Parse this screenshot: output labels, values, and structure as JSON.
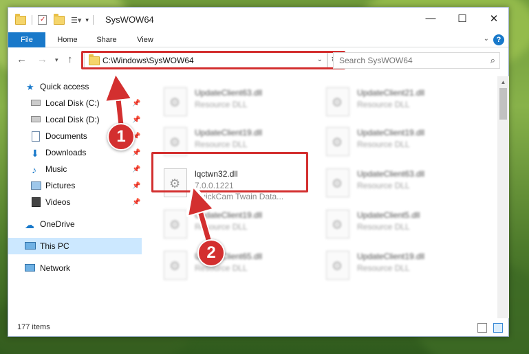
{
  "window": {
    "title": "SysWOW64",
    "controls": {
      "minimize": "—",
      "maximize": "☐",
      "close": "✕"
    }
  },
  "ribbon": {
    "tabs": [
      "File",
      "Home",
      "Share",
      "View"
    ],
    "help": "?"
  },
  "address": {
    "path": "C:\\Windows\\SysWOW64",
    "search_placeholder": "Search SysWOW64"
  },
  "sidebar": {
    "items": [
      {
        "label": "Quick access",
        "icon": "star-icon"
      },
      {
        "label": "Local Disk (C:)",
        "icon": "drive-icon",
        "pinned": true
      },
      {
        "label": "Local Disk (D:)",
        "icon": "drive-icon",
        "pinned": true
      },
      {
        "label": "Documents",
        "icon": "documents-icon",
        "pinned": true
      },
      {
        "label": "Downloads",
        "icon": "downloads-icon",
        "pinned": true
      },
      {
        "label": "Music",
        "icon": "music-icon",
        "pinned": true
      },
      {
        "label": "Pictures",
        "icon": "pictures-icon",
        "pinned": true
      },
      {
        "label": "Videos",
        "icon": "videos-icon",
        "pinned": true
      },
      {
        "label": "OneDrive",
        "icon": "cloud-icon"
      },
      {
        "label": "This PC",
        "icon": "computer-icon",
        "selected": true
      },
      {
        "label": "Network",
        "icon": "network-icon"
      }
    ]
  },
  "files": [
    {
      "name": "UpdateClient63.dll",
      "type": "Resource DLL"
    },
    {
      "name": "UpdateClient21.dll",
      "type": "Resource DLL"
    },
    {
      "name": "UpdateClient19.dll",
      "type": "Resource DLL"
    },
    {
      "name": "UpdateClient19.dll",
      "type": "Resource DLL"
    },
    {
      "name": "lqctwn32.dll",
      "version": "7.0.0.1221",
      "description": "QuickCam Twain Data..."
    },
    {
      "name": "UpdateClient63.dll",
      "type": "Resource DLL"
    },
    {
      "name": "UpdateClient19.dll",
      "type": "Resource DLL"
    },
    {
      "name": "UpdateClient5.dll",
      "type": "Resource DLL"
    },
    {
      "name": "UpdateClient65.dll",
      "type": "Resource DLL"
    },
    {
      "name": "UpdateClient19.dll",
      "type": "Resource DLL"
    }
  ],
  "status": {
    "item_count": "177 items"
  },
  "callouts": {
    "step1": "1",
    "step2": "2"
  },
  "colors": {
    "accent": "#1979ca",
    "highlight": "#d32f2f",
    "selected_bg": "#cce8ff"
  }
}
